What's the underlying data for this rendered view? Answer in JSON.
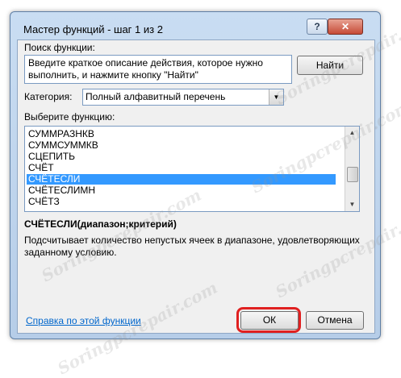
{
  "dialog": {
    "title": "Мастер функций - шаг 1 из 2",
    "help_glyph": "?",
    "close_glyph": "✕"
  },
  "search": {
    "label": "Поиск функции:",
    "text": "Введите краткое описание действия, которое нужно выполнить, и нажмите кнопку \"Найти\"",
    "find_button": "Найти"
  },
  "category": {
    "label": "Категория:",
    "value": "Полный алфавитный перечень"
  },
  "functions": {
    "label": "Выберите функцию:",
    "items": [
      "СУММРАЗНКВ",
      "СУММСУММКВ",
      "СЦЕПИТЬ",
      "СЧЁТ",
      "СЧЁТЕСЛИ",
      "СЧЁТЕСЛИМН",
      "СЧЁТЗ"
    ],
    "selected": "СЧЁТЕСЛИ"
  },
  "selected_function": {
    "syntax": "СЧЁТЕСЛИ(диапазон;критерий)",
    "description": "Подсчитывает количество непустых ячеек в диапазоне, удовлетворяющих заданному условию."
  },
  "footer": {
    "help_link": "Справка по этой функции",
    "ok": "ОК",
    "cancel": "Отмена"
  },
  "watermark": "Soringpcrepair.com",
  "colors": {
    "selection": "#3399ff",
    "highlight_ring": "#e02020",
    "link": "#0066cc"
  }
}
